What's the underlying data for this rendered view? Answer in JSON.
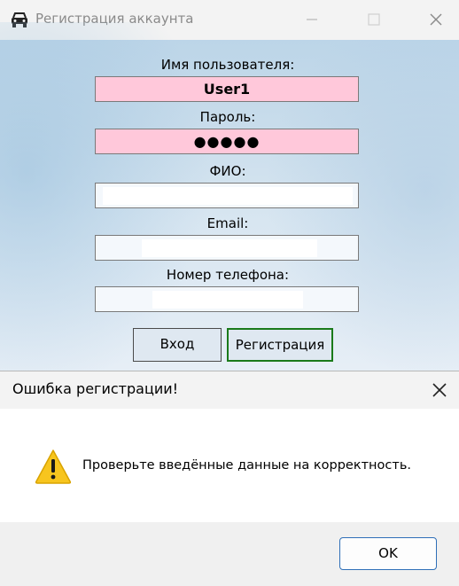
{
  "window": {
    "title": "Регистрация аккаунта",
    "icon": "car-icon"
  },
  "form": {
    "username_label": "Имя пользователя:",
    "username_value": "User1",
    "password_label": "Пароль:",
    "password_value": "●●●●●",
    "fullname_label": "ФИО:",
    "fullname_value": "",
    "email_label": "Email:",
    "email_value": "",
    "phone_label": "Номер телефона:",
    "phone_value": "",
    "login_button": "Вход",
    "register_button": "Регистрация"
  },
  "dialog": {
    "title": "Ошибка регистрации!",
    "message": "Проверьте введённые данные на корректность.",
    "ok_button": "OK",
    "icon": "warning-icon"
  },
  "colors": {
    "invalid_field": "#ffc8da",
    "register_border": "#1a7a1a",
    "ok_border": "#2f6fb8"
  }
}
